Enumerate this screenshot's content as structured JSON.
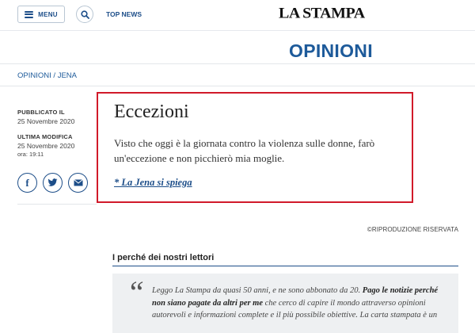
{
  "header": {
    "menu_label": "MENU",
    "top_news_label": "TOP NEWS",
    "logo_text": "LA STAMPA"
  },
  "section": {
    "title": "OPINIONI"
  },
  "breadcrumb": {
    "parent": "OPINIONI",
    "separator": " / ",
    "current": "JENA"
  },
  "meta": {
    "published_label": "PUBBLICATO IL",
    "published_date": "25 Novembre 2020",
    "modified_label": "ULTIMA MODIFICA",
    "modified_date": "25 Novembre 2020",
    "modified_time": "ora: 19:11"
  },
  "share": {
    "icons": [
      "facebook-icon",
      "twitter-icon",
      "email-icon"
    ]
  },
  "article": {
    "title": "Eccezioni",
    "body": "Visto che oggi è la giornata contro la violenza sulle donne, farò un'eccezione e non picchierò mia moglie.",
    "link_text": "* La Jena si spiega"
  },
  "copyright": "©RIPRODUZIONE RISERVATA",
  "readers": {
    "title": "I perché dei nostri lettori",
    "quote_part1": "Leggo La Stampa da quasi 50 anni, e ne sono abbonato da 20. ",
    "quote_bold": "Pago le notizie perché non siano pagate da altri per me",
    "quote_part2": " che cerco di capire il mondo attraverso opinioni autorevoli e informazioni complete e il più possibile obiettive. La carta stampata è un"
  },
  "colors": {
    "brand_blue": "#1d4e89",
    "section_blue": "#1d5a9a",
    "highlight_red": "#d11a2a"
  }
}
